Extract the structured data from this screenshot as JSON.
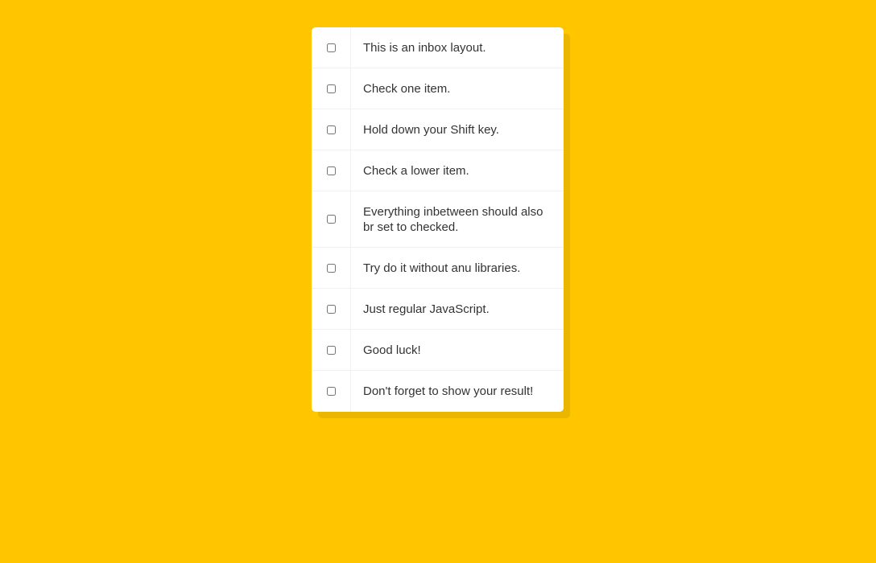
{
  "colors": {
    "background": "#ffc600",
    "card": "#ffffff",
    "text": "#333333"
  },
  "inbox": {
    "items": [
      {
        "label": "This is an inbox layout.",
        "checked": false
      },
      {
        "label": "Check one item.",
        "checked": false
      },
      {
        "label": "Hold down your Shift key.",
        "checked": false
      },
      {
        "label": "Check a lower item.",
        "checked": false
      },
      {
        "label": "Everything inbetween should also br set to checked.",
        "checked": false
      },
      {
        "label": "Try do it without anu libraries.",
        "checked": false
      },
      {
        "label": "Just regular JavaScript.",
        "checked": false
      },
      {
        "label": "Good luck!",
        "checked": false
      },
      {
        "label": "Don't forget to show your result!",
        "checked": false
      }
    ]
  }
}
